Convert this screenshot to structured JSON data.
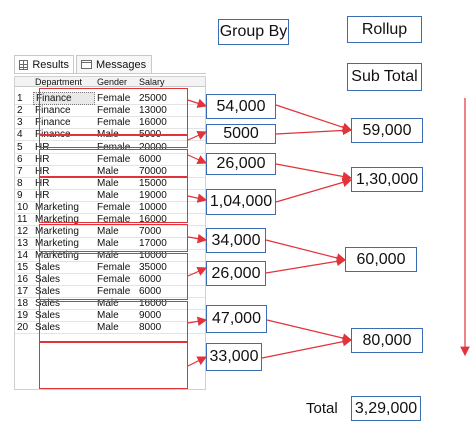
{
  "headers": {
    "group_by": "Group By",
    "rollup": "Rollup",
    "sub_total": "Sub Total"
  },
  "tabs": {
    "results": "Results",
    "messages": "Messages"
  },
  "grid": {
    "columns": [
      "Department",
      "Gender",
      "Salary"
    ],
    "rows": [
      {
        "n": "1",
        "dept": "Finance",
        "gender": "Female",
        "salary": "25000"
      },
      {
        "n": "2",
        "dept": "Finance",
        "gender": "Female",
        "salary": "13000"
      },
      {
        "n": "3",
        "dept": "Finance",
        "gender": "Female",
        "salary": "16000"
      },
      {
        "n": "4",
        "dept": "Finance",
        "gender": "Male",
        "salary": "5000"
      },
      {
        "n": "5",
        "dept": "HR",
        "gender": "Female",
        "salary": "20000"
      },
      {
        "n": "6",
        "dept": "HR",
        "gender": "Female",
        "salary": "6000"
      },
      {
        "n": "7",
        "dept": "HR",
        "gender": "Male",
        "salary": "70000"
      },
      {
        "n": "8",
        "dept": "HR",
        "gender": "Male",
        "salary": "15000"
      },
      {
        "n": "9",
        "dept": "HR",
        "gender": "Male",
        "salary": "19000"
      },
      {
        "n": "10",
        "dept": "Marketing",
        "gender": "Female",
        "salary": "10000"
      },
      {
        "n": "11",
        "dept": "Marketing",
        "gender": "Female",
        "salary": "16000"
      },
      {
        "n": "12",
        "dept": "Marketing",
        "gender": "Male",
        "salary": "7000"
      },
      {
        "n": "13",
        "dept": "Marketing",
        "gender": "Male",
        "salary": "17000"
      },
      {
        "n": "14",
        "dept": "Marketing",
        "gender": "Male",
        "salary": "10000"
      },
      {
        "n": "15",
        "dept": "Sales",
        "gender": "Female",
        "salary": "35000"
      },
      {
        "n": "16",
        "dept": "Sales",
        "gender": "Female",
        "salary": "6000"
      },
      {
        "n": "17",
        "dept": "Sales",
        "gender": "Female",
        "salary": "6000"
      },
      {
        "n": "18",
        "dept": "Sales",
        "gender": "Male",
        "salary": "16000"
      },
      {
        "n": "19",
        "dept": "Sales",
        "gender": "Male",
        "salary": "9000"
      },
      {
        "n": "20",
        "dept": "Sales",
        "gender": "Male",
        "salary": "8000"
      }
    ]
  },
  "group_totals": [
    "54,000",
    "5000",
    "26,000",
    "1,04,000",
    "34,000",
    "26,000",
    "47,000",
    "33,000"
  ],
  "rollup_totals": [
    "59,000",
    "1,30,000",
    "60,000",
    "80,000"
  ],
  "grand_total": {
    "label": "Total",
    "value": "3,29,000"
  },
  "colors": {
    "accent_blue": "#3b6db4",
    "annotation_red": "#e2333a"
  },
  "icons": {
    "results_tab": "grid-icon",
    "messages_tab": "message-icon"
  }
}
